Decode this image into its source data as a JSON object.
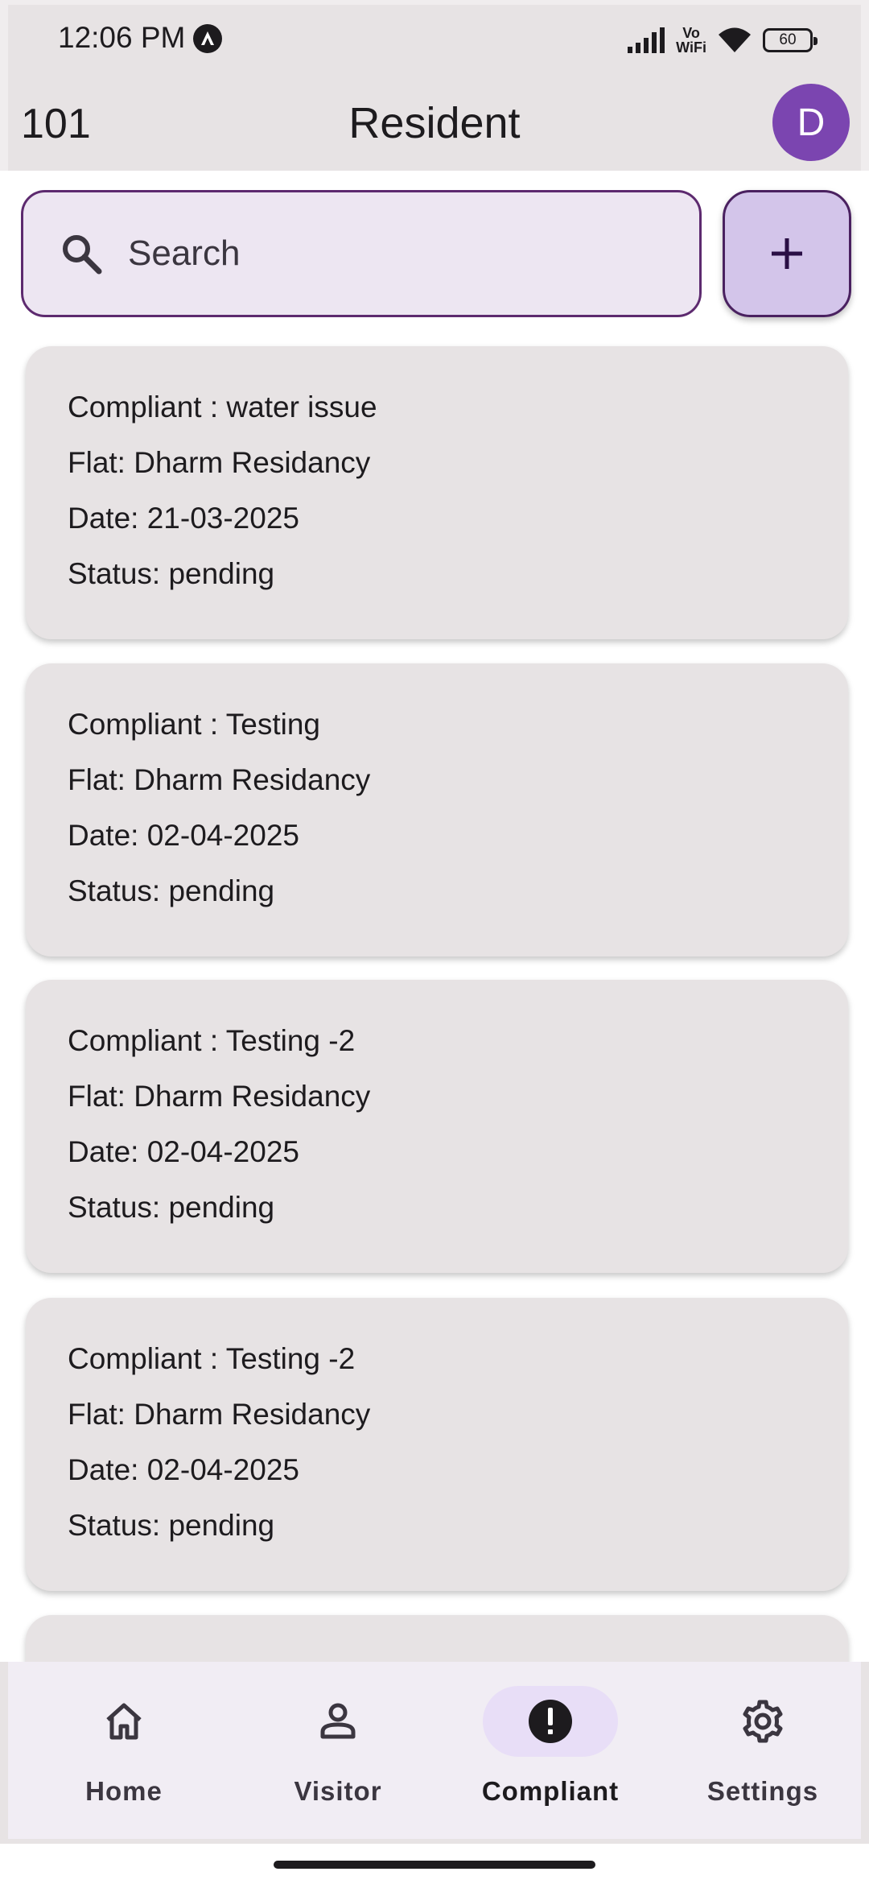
{
  "status_bar": {
    "time": "12:06 PM",
    "vowifi_top": "Vo",
    "vowifi_bottom": "WiFi",
    "battery": "60"
  },
  "app_bar": {
    "unit": "101",
    "title": "Resident",
    "avatar_initial": "D",
    "avatar_color": "#7b45b0"
  },
  "search": {
    "placeholder": "Search",
    "icon": "search-icon"
  },
  "add_button": {
    "icon": "plus-icon"
  },
  "complaints": [
    {
      "complaint": "Compliant : water issue",
      "flat": "Flat: Dharm Residancy",
      "date": "Date: 21-03-2025",
      "status": "Status: pending"
    },
    {
      "complaint": "Compliant : Testing",
      "flat": "Flat: Dharm Residancy",
      "date": "Date: 02-04-2025",
      "status": "Status: pending"
    },
    {
      "complaint": "Compliant : Testing -2",
      "flat": "Flat: Dharm Residancy",
      "date": "Date: 02-04-2025",
      "status": "Status: pending"
    },
    {
      "complaint": "Compliant : Testing -2",
      "flat": "Flat: Dharm Residancy",
      "date": "Date: 02-04-2025",
      "status": "Status: pending"
    }
  ],
  "bottom_nav": {
    "items": [
      {
        "label": "Home",
        "icon": "home-icon",
        "active": false
      },
      {
        "label": "Visitor",
        "icon": "person-icon",
        "active": false
      },
      {
        "label": "Compliant",
        "icon": "alert-circle-icon",
        "active": true
      },
      {
        "label": "Settings",
        "icon": "gear-icon",
        "active": false
      }
    ]
  },
  "colors": {
    "accent": "#5d2a6f",
    "active_pill": "#e8def7",
    "card_bg": "#e7e3e4"
  }
}
